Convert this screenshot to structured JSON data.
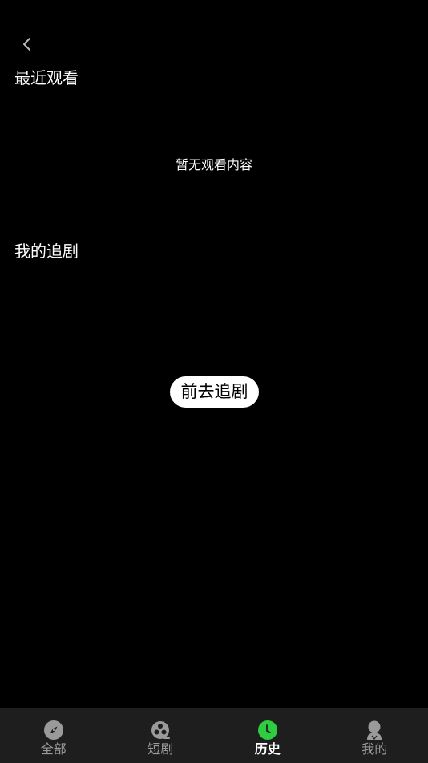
{
  "header": {
    "back_icon": "chevron-left-icon"
  },
  "recent": {
    "title": "最近观看",
    "empty_text": "暂无观看内容"
  },
  "follow": {
    "title": "我的追剧",
    "button_label": "前去追剧"
  },
  "tabbar": {
    "active_color": "#2ecc40",
    "inactive_color": "#9a9a9a",
    "items": [
      {
        "label": "全部",
        "icon": "compass-icon",
        "active": false
      },
      {
        "label": "短剧",
        "icon": "film-reel-icon",
        "active": false
      },
      {
        "label": "历史",
        "icon": "clock-icon",
        "active": true
      },
      {
        "label": "我的",
        "icon": "user-icon",
        "active": false
      }
    ]
  }
}
